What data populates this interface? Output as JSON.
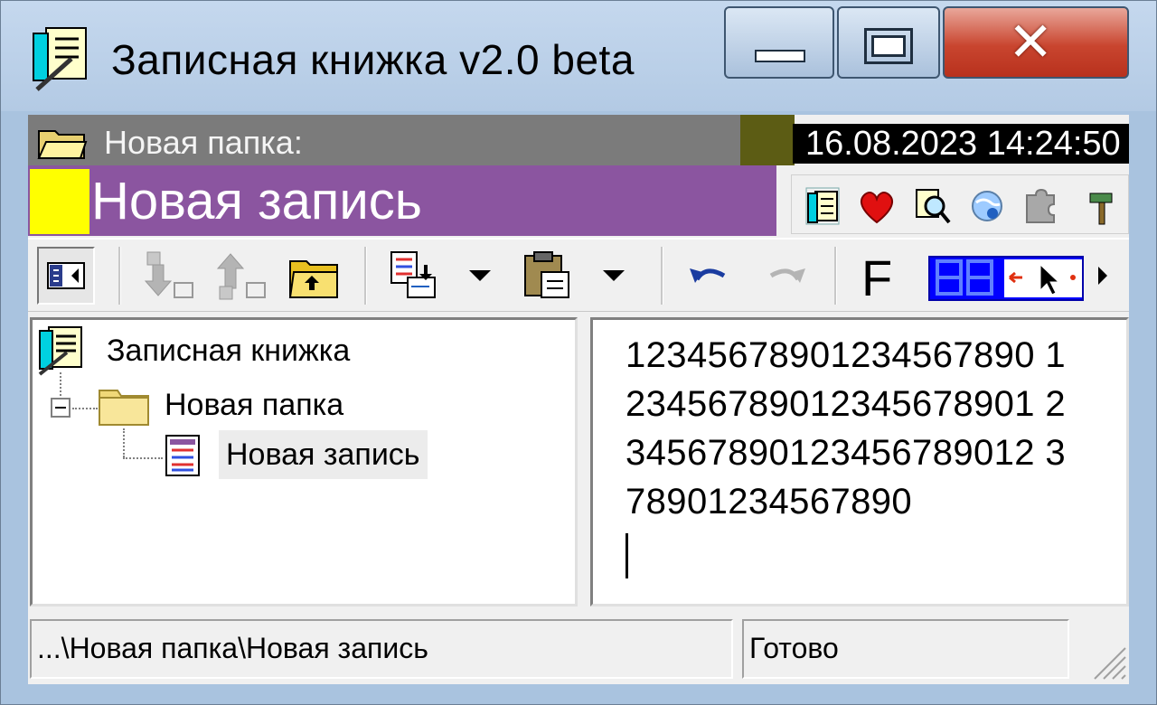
{
  "window": {
    "title": "Записная книжка v2.0 beta",
    "controls": {
      "minimize": "minimize",
      "maximize": "maximize",
      "close": "close"
    }
  },
  "header": {
    "folder_title": "Новая папка:",
    "datetime": "16.08.2023  14:24:50",
    "record_title": "Новая запись",
    "colors": {
      "record_band": "#8b55a0",
      "folder_band": "#7b7b7b",
      "marker": "#ffff00"
    }
  },
  "mini_toolbar": {
    "icons": [
      "notebook-icon",
      "heart-icon",
      "search-doc-icon",
      "globe-icon",
      "puzzle-icon",
      "hammer-icon"
    ]
  },
  "toolbar": {
    "icons": [
      "panel-toggle-icon",
      "move-down-icon",
      "move-up-icon",
      "folder-up-icon",
      "document-insert-icon",
      "paste-icon",
      "undo-icon",
      "redo-icon"
    ],
    "font_label": "F"
  },
  "tree": {
    "root": "Записная книжка",
    "folder": "Новая папка",
    "record": "Новая запись"
  },
  "editor": {
    "lines": [
      "12345678901234567890 1",
      "23456789012345678901 2",
      "34567890123456789012 3",
      "78901234567890"
    ]
  },
  "status": {
    "path": "...\\Новая папка\\Новая запись",
    "state": "Готово"
  }
}
